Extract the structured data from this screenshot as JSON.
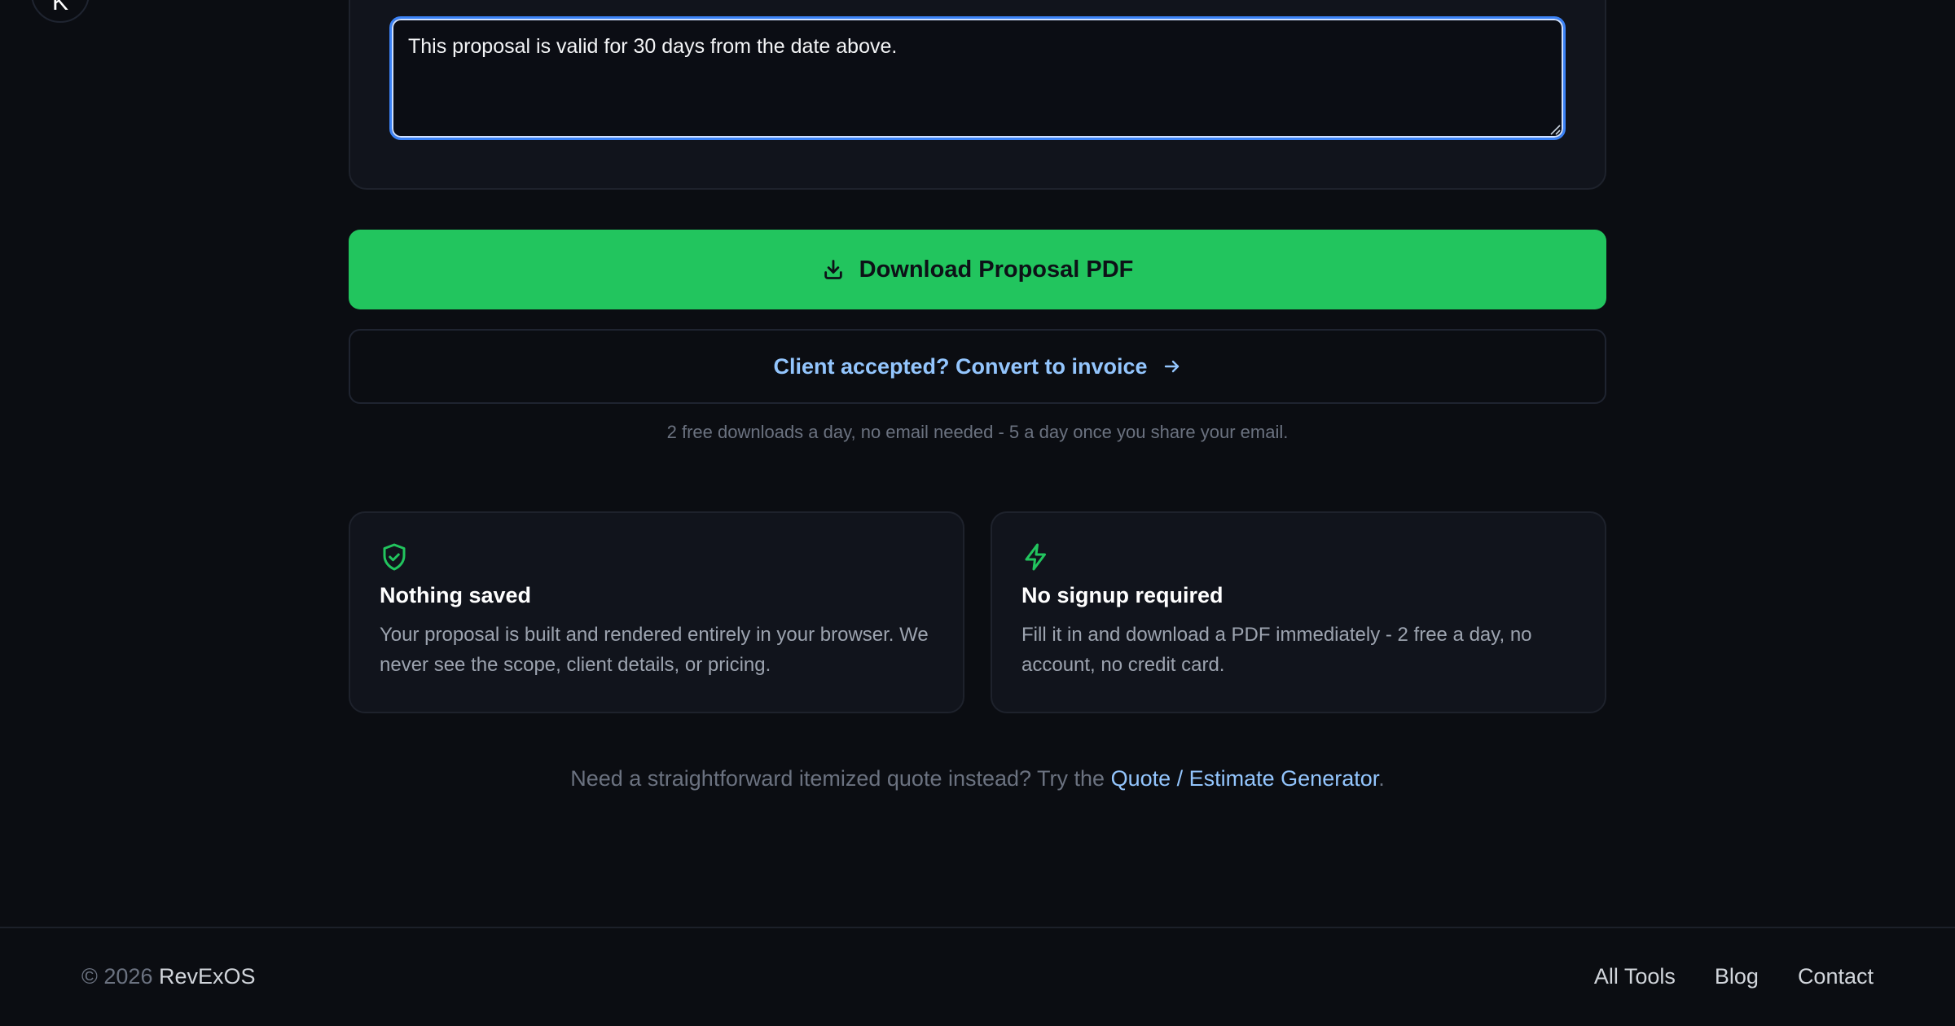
{
  "avatar": {
    "letter": "K"
  },
  "terms": {
    "value": "This proposal is valid for 30 days from the date above."
  },
  "actions": {
    "download_label": "Download Proposal PDF",
    "convert_label": "Client accepted? Convert to invoice",
    "downloads_note": "2 free downloads a day, no email needed - 5 a day once you share your email."
  },
  "features": [
    {
      "icon": "shield-check-icon",
      "title": "Nothing saved",
      "text": "Your proposal is built and rendered entirely in your browser. We never see the scope, client details, or pricing."
    },
    {
      "icon": "lightning-icon",
      "title": "No signup required",
      "text": "Fill it in and download a PDF immediately - 2 free a day, no account, no credit card."
    }
  ],
  "quote_cta": {
    "prefix": "Need a straightforward itemized quote instead? Try the ",
    "link_label": "Quote / Estimate Generator",
    "suffix": "."
  },
  "footer": {
    "copyright": "© 2026 ",
    "brand": "RevExOS",
    "links": [
      "All Tools",
      "Blog",
      "Contact"
    ]
  },
  "colors": {
    "background": "#0b0d12",
    "accent_green": "#22c55e",
    "link_blue": "#93c5fd",
    "focus_blue": "#3b82f6"
  }
}
